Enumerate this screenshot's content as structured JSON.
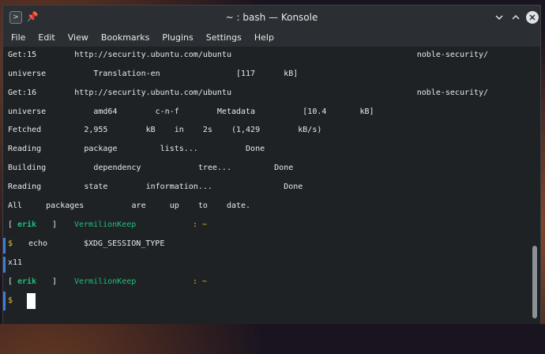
{
  "window": {
    "title": "~ : bash — Konsole",
    "menus": [
      "File",
      "Edit",
      "View",
      "Bookmarks",
      "Plugins",
      "Settings",
      "Help"
    ]
  },
  "terminal": {
    "lines": [
      {
        "text": "Get:15        http://security.ubuntu.com/ubuntu                                       noble-security/"
      },
      {
        "text": "universe          Translation-en                [117      kB]"
      },
      {
        "text": "Get:16        http://security.ubuntu.com/ubuntu                                       noble-security/"
      },
      {
        "text": "universe          amd64        c-n-f        Metadata          [10.4       kB]"
      },
      {
        "text": "Fetched         2,955        kB    in    2s    (1,429        kB/s)"
      },
      {
        "text": "Reading         package         lists...          Done"
      },
      {
        "text": "Building          dependency            tree...         Done"
      },
      {
        "text": "Reading         state        information...               Done"
      },
      {
        "text": "All     packages          are     up    to    date."
      }
    ],
    "prompt1": {
      "open": "[",
      "user": "erik",
      "close": "]",
      "host": "VermilionKeep",
      "path": ": ~"
    },
    "command": {
      "symbol": "$",
      "cmd": "echo",
      "arg": "$XDG_SESSION_TYPE"
    },
    "output": "x11",
    "prompt2": {
      "open": "[",
      "user": "erik",
      "close": "]",
      "host": "VermilionKeep",
      "path": ": ~"
    },
    "prompt_symbol": "$"
  }
}
